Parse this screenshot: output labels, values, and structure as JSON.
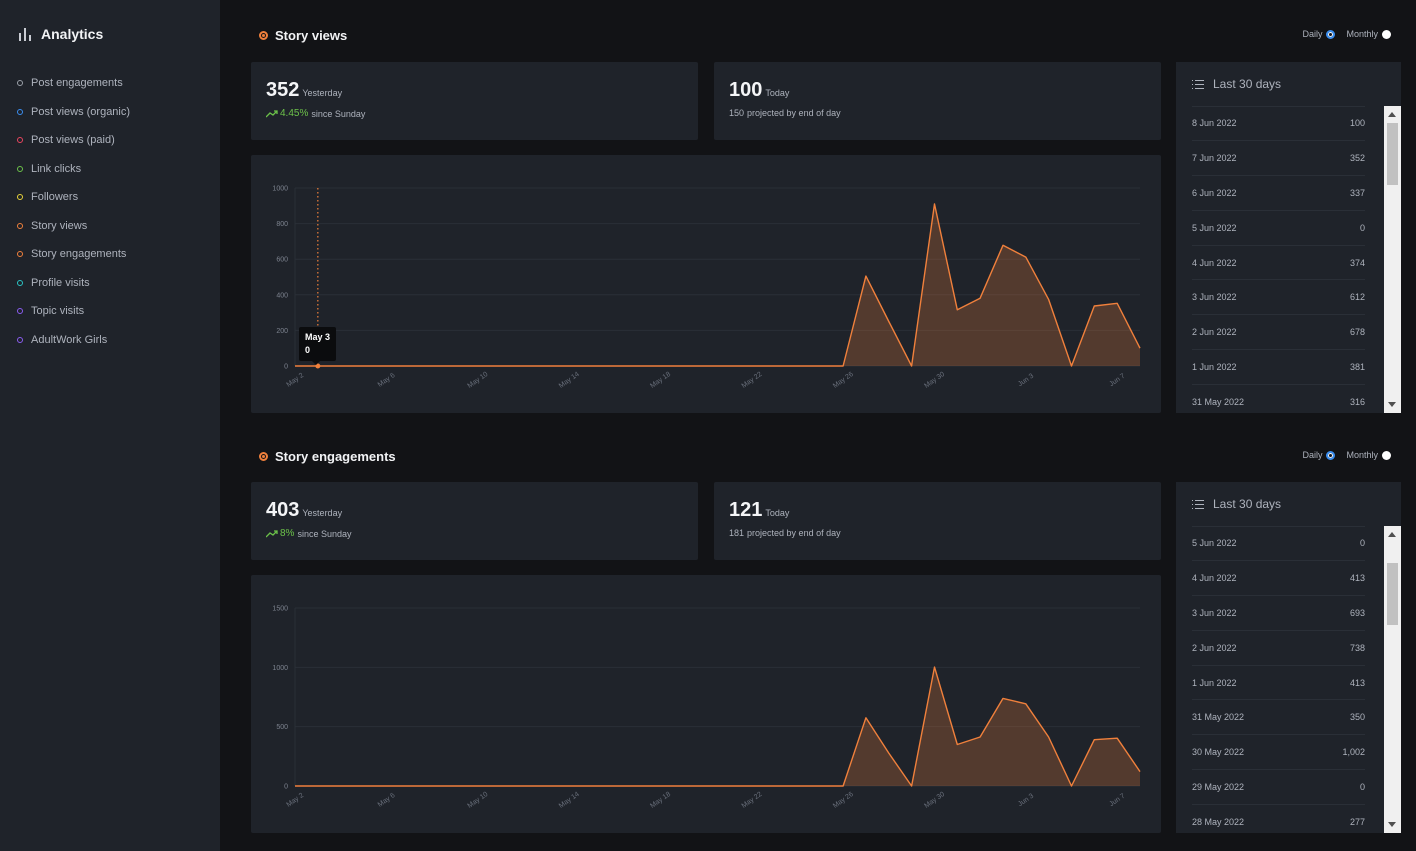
{
  "sidebar": {
    "title": "Analytics",
    "items": [
      {
        "label": "Post engagements",
        "color": "#9aa0a8"
      },
      {
        "label": "Post views (organic)",
        "color": "#3a8ef0"
      },
      {
        "label": "Post views (paid)",
        "color": "#e8455f"
      },
      {
        "label": "Link clicks",
        "color": "#6cc24a"
      },
      {
        "label": "Followers",
        "color": "#e8d33a"
      },
      {
        "label": "Story views",
        "color": "#f0803c"
      },
      {
        "label": "Story engagements",
        "color": "#f0803c"
      },
      {
        "label": "Profile visits",
        "color": "#2bc4c4"
      },
      {
        "label": "Topic visits",
        "color": "#8a5cf0"
      },
      {
        "label": "AdultWork Girls",
        "color": "#8a5cf0"
      }
    ]
  },
  "sections": [
    {
      "title": "Story views",
      "toggle": {
        "daily": "Daily",
        "monthly": "Monthly",
        "selected": "Daily"
      },
      "yesterday": {
        "value": "352",
        "label": "Yesterday",
        "trend": "4.45%",
        "trend_label": "since Sunday"
      },
      "today": {
        "value": "100",
        "label": "Today",
        "projected": "150",
        "projected_label": "projected by end of day"
      },
      "tooltip": {
        "date": "May 3",
        "value": "0"
      },
      "list": {
        "title": "Last 30 days",
        "rows": [
          {
            "date": "8 Jun 2022",
            "value": "100"
          },
          {
            "date": "7 Jun 2022",
            "value": "352"
          },
          {
            "date": "6 Jun 2022",
            "value": "337"
          },
          {
            "date": "5 Jun 2022",
            "value": "0"
          },
          {
            "date": "4 Jun 2022",
            "value": "374"
          },
          {
            "date": "3 Jun 2022",
            "value": "612"
          },
          {
            "date": "2 Jun 2022",
            "value": "678"
          },
          {
            "date": "1 Jun 2022",
            "value": "381"
          },
          {
            "date": "31 May 2022",
            "value": "316"
          }
        ]
      }
    },
    {
      "title": "Story engagements",
      "toggle": {
        "daily": "Daily",
        "monthly": "Monthly",
        "selected": "Daily"
      },
      "yesterday": {
        "value": "403",
        "label": "Yesterday",
        "trend": "8%",
        "trend_label": "since Sunday"
      },
      "today": {
        "value": "121",
        "label": "Today",
        "projected": "181",
        "projected_label": "projected by end of day"
      },
      "list": {
        "title": "Last 30 days",
        "rows": [
          {
            "date": "5 Jun 2022",
            "value": "0"
          },
          {
            "date": "4 Jun 2022",
            "value": "413"
          },
          {
            "date": "3 Jun 2022",
            "value": "693"
          },
          {
            "date": "2 Jun 2022",
            "value": "738"
          },
          {
            "date": "1 Jun 2022",
            "value": "413"
          },
          {
            "date": "31 May 2022",
            "value": "350"
          },
          {
            "date": "30 May 2022",
            "value": "1,002"
          },
          {
            "date": "29 May 2022",
            "value": "0"
          },
          {
            "date": "28 May 2022",
            "value": "277"
          }
        ]
      }
    }
  ],
  "chart_data": [
    {
      "type": "area",
      "title": "Story views",
      "color": "#f0803c",
      "x_ticks": [
        "May 2",
        "May 6",
        "May 10",
        "May 14",
        "May 18",
        "May 22",
        "May 26",
        "May 30",
        "Jun 3",
        "Jun 7"
      ],
      "y_ticks": [
        0,
        200,
        400,
        600,
        800,
        1000
      ],
      "ylim": [
        0,
        1000
      ],
      "x": [
        "May 2",
        "May 3",
        "May 4",
        "May 5",
        "May 6",
        "May 7",
        "May 8",
        "May 9",
        "May 10",
        "May 11",
        "May 12",
        "May 13",
        "May 14",
        "May 15",
        "May 16",
        "May 17",
        "May 18",
        "May 19",
        "May 20",
        "May 21",
        "May 22",
        "May 23",
        "May 24",
        "May 25",
        "May 26",
        "May 27",
        "May 28",
        "May 29",
        "May 30",
        "May 31",
        "Jun 1",
        "Jun 2",
        "Jun 3",
        "Jun 4",
        "Jun 5",
        "Jun 6",
        "Jun 7",
        "Jun 8"
      ],
      "values": [
        0,
        0,
        0,
        0,
        0,
        0,
        0,
        0,
        0,
        0,
        0,
        0,
        0,
        0,
        0,
        0,
        0,
        0,
        0,
        0,
        0,
        0,
        0,
        0,
        0,
        505,
        250,
        0,
        910,
        316,
        381,
        678,
        612,
        374,
        0,
        337,
        352,
        100
      ]
    },
    {
      "type": "area",
      "title": "Story engagements",
      "color": "#f0803c",
      "x_ticks": [
        "May 2",
        "May 6",
        "May 10",
        "May 14",
        "May 18",
        "May 22",
        "May 26",
        "May 30",
        "Jun 3",
        "Jun 7"
      ],
      "y_ticks": [
        0,
        500,
        1000,
        1500
      ],
      "ylim": [
        0,
        1500
      ],
      "x": [
        "May 2",
        "May 3",
        "May 4",
        "May 5",
        "May 6",
        "May 7",
        "May 8",
        "May 9",
        "May 10",
        "May 11",
        "May 12",
        "May 13",
        "May 14",
        "May 15",
        "May 16",
        "May 17",
        "May 18",
        "May 19",
        "May 20",
        "May 21",
        "May 22",
        "May 23",
        "May 24",
        "May 25",
        "May 26",
        "May 27",
        "May 28",
        "May 29",
        "May 30",
        "May 31",
        "Jun 1",
        "Jun 2",
        "Jun 3",
        "Jun 4",
        "Jun 5",
        "Jun 6",
        "Jun 7",
        "Jun 8"
      ],
      "values": [
        0,
        0,
        0,
        0,
        0,
        0,
        0,
        0,
        0,
        0,
        0,
        0,
        0,
        0,
        0,
        0,
        0,
        0,
        0,
        0,
        0,
        0,
        0,
        0,
        0,
        575,
        277,
        0,
        1002,
        350,
        413,
        738,
        693,
        413,
        0,
        390,
        403,
        121
      ]
    }
  ]
}
